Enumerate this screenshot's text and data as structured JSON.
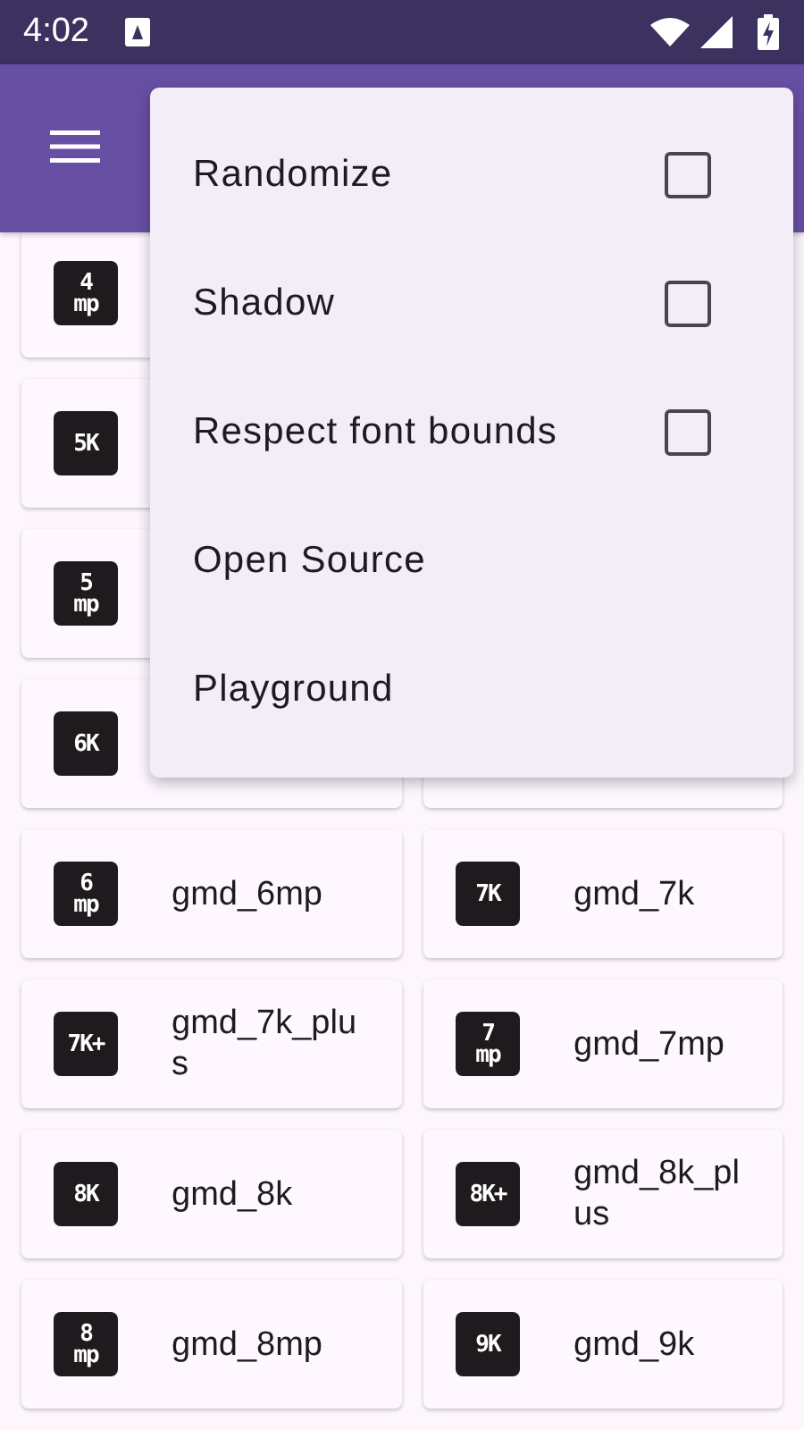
{
  "status_bar": {
    "time": "4:02"
  },
  "menu": {
    "items": [
      {
        "kind": "checkbox",
        "label": "Randomize",
        "checked": false
      },
      {
        "kind": "checkbox",
        "label": "Shadow",
        "checked": false
      },
      {
        "kind": "checkbox",
        "label": "Respect font bounds",
        "checked": false
      },
      {
        "kind": "action",
        "label": "Open Source"
      },
      {
        "kind": "action",
        "label": "Playground"
      }
    ]
  },
  "grid": {
    "rows": [
      {
        "cards": [
          {
            "kind": "icon",
            "badge": [
              "4",
              "mp"
            ]
          }
        ]
      },
      {
        "cards": [
          {
            "kind": "icon",
            "badge": [
              "5K"
            ]
          }
        ]
      },
      {
        "cards": [
          {
            "kind": "icon",
            "badge": [
              "5",
              "mp"
            ]
          }
        ]
      },
      {
        "cards": [
          {
            "kind": "icon",
            "badge": [
              "6K"
            ]
          },
          {
            "kind": "covered"
          }
        ]
      },
      {
        "cards": [
          {
            "kind": "icon",
            "badge": [
              "6",
              "mp"
            ],
            "label": "gmd_6mp"
          },
          {
            "kind": "icon",
            "badge": [
              "7K"
            ],
            "label": "gmd_7k"
          }
        ]
      },
      {
        "cards": [
          {
            "kind": "icon",
            "badge": [
              "7K+"
            ],
            "label": "gmd_7k_plus"
          },
          {
            "kind": "icon",
            "badge": [
              "7",
              "mp"
            ],
            "label": "gmd_7mp"
          }
        ]
      },
      {
        "cards": [
          {
            "kind": "icon",
            "badge": [
              "8K"
            ],
            "label": "gmd_8k"
          },
          {
            "kind": "icon",
            "badge": [
              "8K+"
            ],
            "label": "gmd_8k_plus"
          }
        ]
      },
      {
        "cards": [
          {
            "kind": "icon",
            "badge": [
              "8",
              "mp"
            ],
            "label": "gmd_8mp"
          },
          {
            "kind": "icon",
            "badge": [
              "9K"
            ],
            "label": "gmd_9k"
          }
        ]
      }
    ]
  }
}
